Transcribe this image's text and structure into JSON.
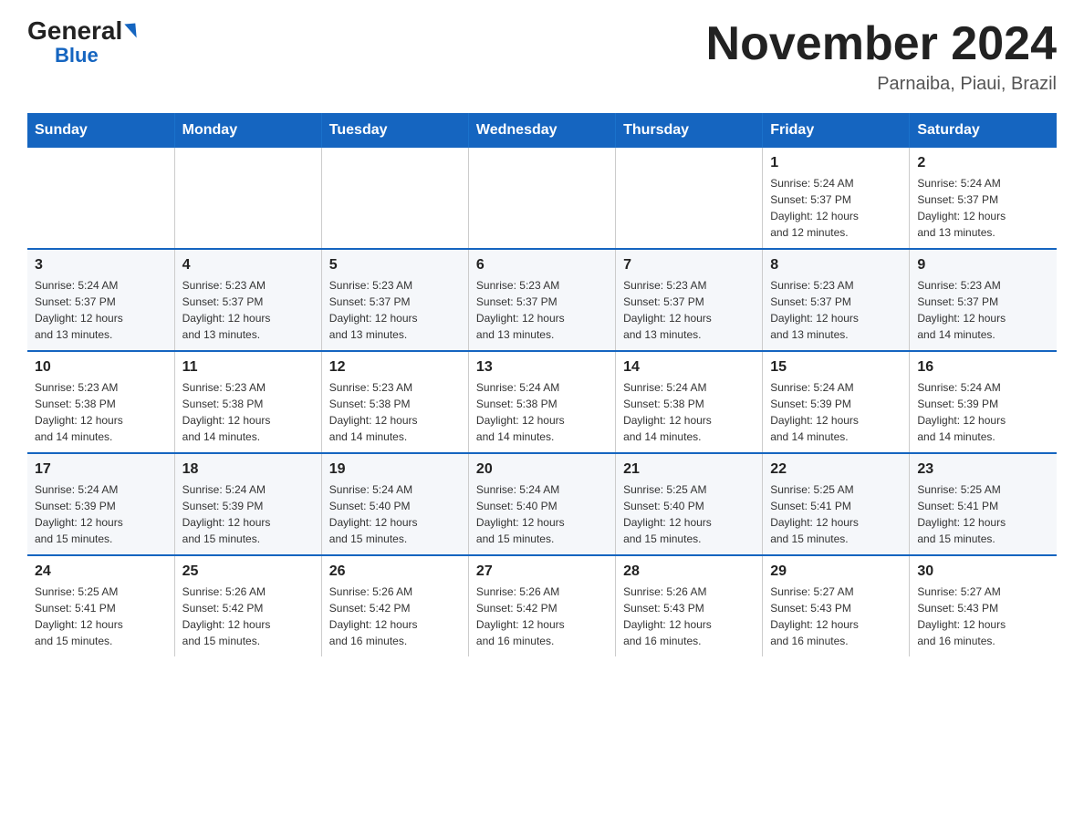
{
  "logo": {
    "general": "General",
    "triangle": "▶",
    "blue": "Blue"
  },
  "title": "November 2024",
  "location": "Parnaiba, Piaui, Brazil",
  "weekdays": [
    "Sunday",
    "Monday",
    "Tuesday",
    "Wednesday",
    "Thursday",
    "Friday",
    "Saturday"
  ],
  "weeks": [
    [
      {
        "day": "",
        "info": ""
      },
      {
        "day": "",
        "info": ""
      },
      {
        "day": "",
        "info": ""
      },
      {
        "day": "",
        "info": ""
      },
      {
        "day": "",
        "info": ""
      },
      {
        "day": "1",
        "info": "Sunrise: 5:24 AM\nSunset: 5:37 PM\nDaylight: 12 hours\nand 12 minutes."
      },
      {
        "day": "2",
        "info": "Sunrise: 5:24 AM\nSunset: 5:37 PM\nDaylight: 12 hours\nand 13 minutes."
      }
    ],
    [
      {
        "day": "3",
        "info": "Sunrise: 5:24 AM\nSunset: 5:37 PM\nDaylight: 12 hours\nand 13 minutes."
      },
      {
        "day": "4",
        "info": "Sunrise: 5:23 AM\nSunset: 5:37 PM\nDaylight: 12 hours\nand 13 minutes."
      },
      {
        "day": "5",
        "info": "Sunrise: 5:23 AM\nSunset: 5:37 PM\nDaylight: 12 hours\nand 13 minutes."
      },
      {
        "day": "6",
        "info": "Sunrise: 5:23 AM\nSunset: 5:37 PM\nDaylight: 12 hours\nand 13 minutes."
      },
      {
        "day": "7",
        "info": "Sunrise: 5:23 AM\nSunset: 5:37 PM\nDaylight: 12 hours\nand 13 minutes."
      },
      {
        "day": "8",
        "info": "Sunrise: 5:23 AM\nSunset: 5:37 PM\nDaylight: 12 hours\nand 13 minutes."
      },
      {
        "day": "9",
        "info": "Sunrise: 5:23 AM\nSunset: 5:37 PM\nDaylight: 12 hours\nand 14 minutes."
      }
    ],
    [
      {
        "day": "10",
        "info": "Sunrise: 5:23 AM\nSunset: 5:38 PM\nDaylight: 12 hours\nand 14 minutes."
      },
      {
        "day": "11",
        "info": "Sunrise: 5:23 AM\nSunset: 5:38 PM\nDaylight: 12 hours\nand 14 minutes."
      },
      {
        "day": "12",
        "info": "Sunrise: 5:23 AM\nSunset: 5:38 PM\nDaylight: 12 hours\nand 14 minutes."
      },
      {
        "day": "13",
        "info": "Sunrise: 5:24 AM\nSunset: 5:38 PM\nDaylight: 12 hours\nand 14 minutes."
      },
      {
        "day": "14",
        "info": "Sunrise: 5:24 AM\nSunset: 5:38 PM\nDaylight: 12 hours\nand 14 minutes."
      },
      {
        "day": "15",
        "info": "Sunrise: 5:24 AM\nSunset: 5:39 PM\nDaylight: 12 hours\nand 14 minutes."
      },
      {
        "day": "16",
        "info": "Sunrise: 5:24 AM\nSunset: 5:39 PM\nDaylight: 12 hours\nand 14 minutes."
      }
    ],
    [
      {
        "day": "17",
        "info": "Sunrise: 5:24 AM\nSunset: 5:39 PM\nDaylight: 12 hours\nand 15 minutes."
      },
      {
        "day": "18",
        "info": "Sunrise: 5:24 AM\nSunset: 5:39 PM\nDaylight: 12 hours\nand 15 minutes."
      },
      {
        "day": "19",
        "info": "Sunrise: 5:24 AM\nSunset: 5:40 PM\nDaylight: 12 hours\nand 15 minutes."
      },
      {
        "day": "20",
        "info": "Sunrise: 5:24 AM\nSunset: 5:40 PM\nDaylight: 12 hours\nand 15 minutes."
      },
      {
        "day": "21",
        "info": "Sunrise: 5:25 AM\nSunset: 5:40 PM\nDaylight: 12 hours\nand 15 minutes."
      },
      {
        "day": "22",
        "info": "Sunrise: 5:25 AM\nSunset: 5:41 PM\nDaylight: 12 hours\nand 15 minutes."
      },
      {
        "day": "23",
        "info": "Sunrise: 5:25 AM\nSunset: 5:41 PM\nDaylight: 12 hours\nand 15 minutes."
      }
    ],
    [
      {
        "day": "24",
        "info": "Sunrise: 5:25 AM\nSunset: 5:41 PM\nDaylight: 12 hours\nand 15 minutes."
      },
      {
        "day": "25",
        "info": "Sunrise: 5:26 AM\nSunset: 5:42 PM\nDaylight: 12 hours\nand 15 minutes."
      },
      {
        "day": "26",
        "info": "Sunrise: 5:26 AM\nSunset: 5:42 PM\nDaylight: 12 hours\nand 16 minutes."
      },
      {
        "day": "27",
        "info": "Sunrise: 5:26 AM\nSunset: 5:42 PM\nDaylight: 12 hours\nand 16 minutes."
      },
      {
        "day": "28",
        "info": "Sunrise: 5:26 AM\nSunset: 5:43 PM\nDaylight: 12 hours\nand 16 minutes."
      },
      {
        "day": "29",
        "info": "Sunrise: 5:27 AM\nSunset: 5:43 PM\nDaylight: 12 hours\nand 16 minutes."
      },
      {
        "day": "30",
        "info": "Sunrise: 5:27 AM\nSunset: 5:43 PM\nDaylight: 12 hours\nand 16 minutes."
      }
    ]
  ]
}
